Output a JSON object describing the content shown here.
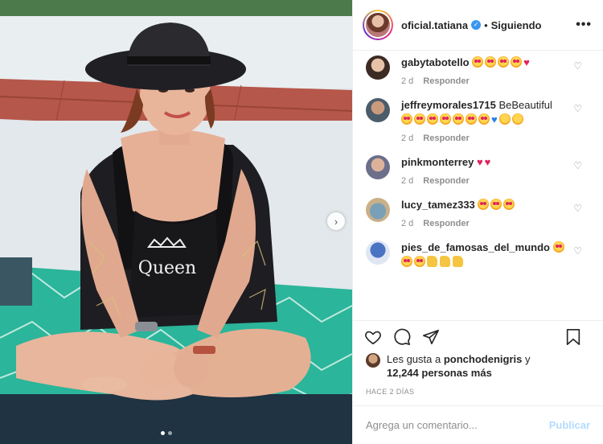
{
  "post": {
    "username": "oficial.tatiana",
    "separator": "•",
    "follow_status": "Siguiendo",
    "more_label": "•••",
    "photo_alt": "Mujer con sombrero negro y traje de baño con la palabra Queen sentada en una toalla en la playa",
    "swimsuit_text": "Queen"
  },
  "comments": [
    {
      "user": "gabytabotello",
      "text": "",
      "emojis": "heart-eyes x4, red-heart",
      "time": "2 d",
      "reply": "Responder"
    },
    {
      "user": "jeffreymorales1715",
      "text": "BeBeautiful",
      "emojis": "heart-eyes x7, blue-heart, face x2",
      "time": "2 d",
      "reply": "Responder"
    },
    {
      "user": "pinkmonterrey",
      "text": "",
      "emojis": "red-heart x2",
      "time": "2 d",
      "reply": "Responder"
    },
    {
      "user": "lucy_tamez333",
      "text": "",
      "emojis": "heart-eyes x3",
      "time": "2 d",
      "reply": "Responder"
    },
    {
      "user": "pies_de_famosas_del_mundo",
      "text": "",
      "emojis": "heart-eyes x3, palm x3",
      "time": "",
      "reply": ""
    }
  ],
  "likes": {
    "prefix": "Les gusta a",
    "user": "ponchodenigris",
    "connector": "y",
    "count": "12,244 personas más"
  },
  "timestamp": "HACE 2 DÍAS",
  "add_comment": {
    "placeholder": "Agrega un comentario...",
    "publish": "Publicar"
  },
  "colors": {
    "verified": "#3897f0",
    "publish_disabled": "#b3dbff",
    "meta_gray": "#8e8e8e",
    "towel": "#2bb59a"
  }
}
